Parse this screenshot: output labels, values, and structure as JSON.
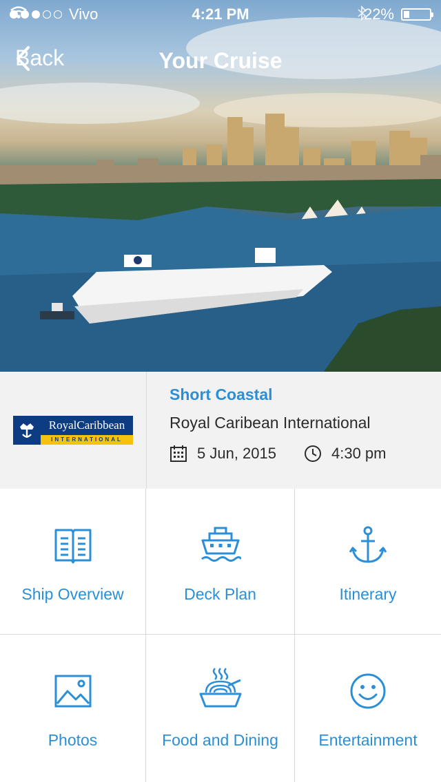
{
  "status": {
    "carrier": "Vivo",
    "time": "4:21 PM",
    "battery": "22%",
    "battery_level": 0.22
  },
  "nav": {
    "back_label": "Back",
    "title": "Your Cruise"
  },
  "cruise": {
    "logo_text": "RoyalCaribbean",
    "logo_subtext": "INTERNATIONAL",
    "type": "Short Coastal",
    "line": "Royal Caribean International",
    "date": "5 Jun, 2015",
    "time": "4:30 pm"
  },
  "menu": [
    {
      "label": "Ship Overview",
      "icon": "book-icon"
    },
    {
      "label": "Deck Plan",
      "icon": "ship-icon"
    },
    {
      "label": "Itinerary",
      "icon": "anchor-icon"
    },
    {
      "label": "Photos",
      "icon": "photo-icon"
    },
    {
      "label": "Food and Dining",
      "icon": "food-bowl-icon"
    },
    {
      "label": "Entertainment",
      "icon": "smiley-icon"
    }
  ],
  "colors": {
    "accent": "#2a8fd6",
    "logo_blue": "#0e3c82",
    "logo_yellow": "#f3c30f"
  }
}
